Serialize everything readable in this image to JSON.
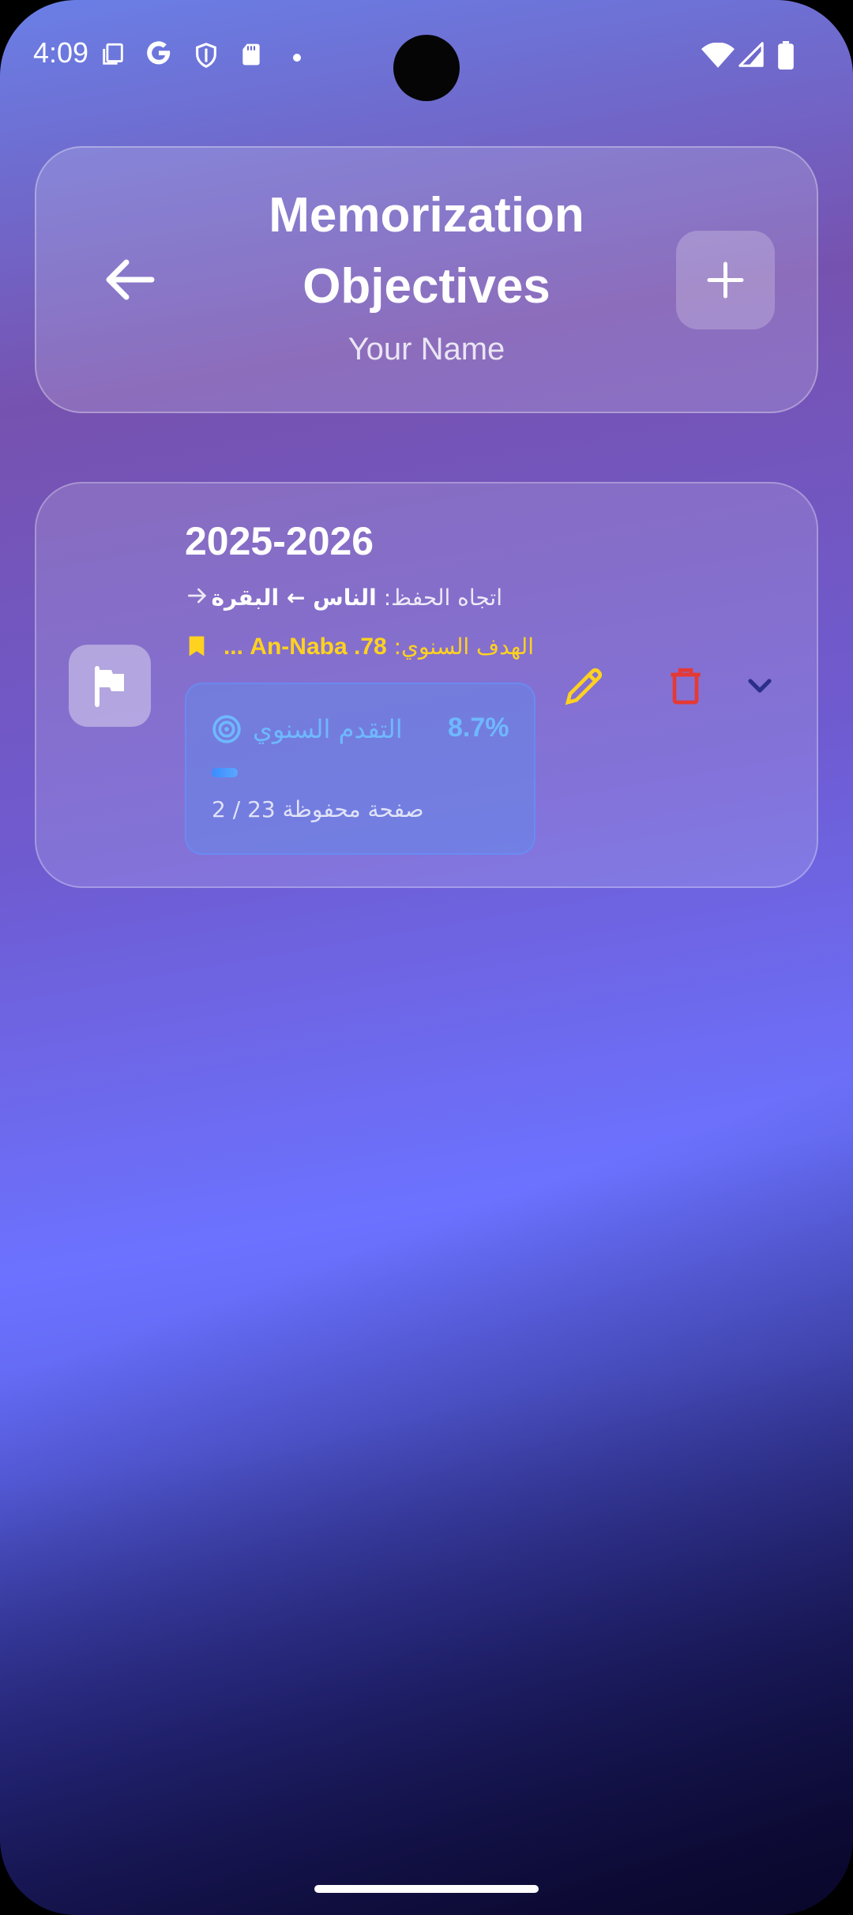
{
  "status_bar": {
    "time": "4:09",
    "left_icons": [
      "copy-icon",
      "google-icon",
      "shield-icon",
      "sd-card-icon",
      "dot-icon"
    ],
    "right_icons": [
      "wifi-icon",
      "signal-icon",
      "battery-icon"
    ]
  },
  "header": {
    "title": "Memorization Objectives",
    "subtitle": "Your Name",
    "back_icon": "arrow-left-icon",
    "add_icon": "plus-icon"
  },
  "objectives": [
    {
      "year": "2025-2026",
      "direction_label": "اتجاه الحفظ:",
      "direction_value": "الناس ← البقرة",
      "goal_label": "الهدف السنوي:",
      "goal_value": "78. An-Naba ...",
      "progress_label": "التقدم السنوي",
      "progress_percent": "8.7%",
      "progress_fraction": 0.087,
      "saved_text": "صفحة محفوظة 23 / 2"
    }
  ],
  "colors": {
    "accent_yellow": "#ffd21f",
    "progress_blue": "#6eb8ff",
    "delete_red": "#e53935",
    "expand_navy": "#2c2f8a"
  }
}
